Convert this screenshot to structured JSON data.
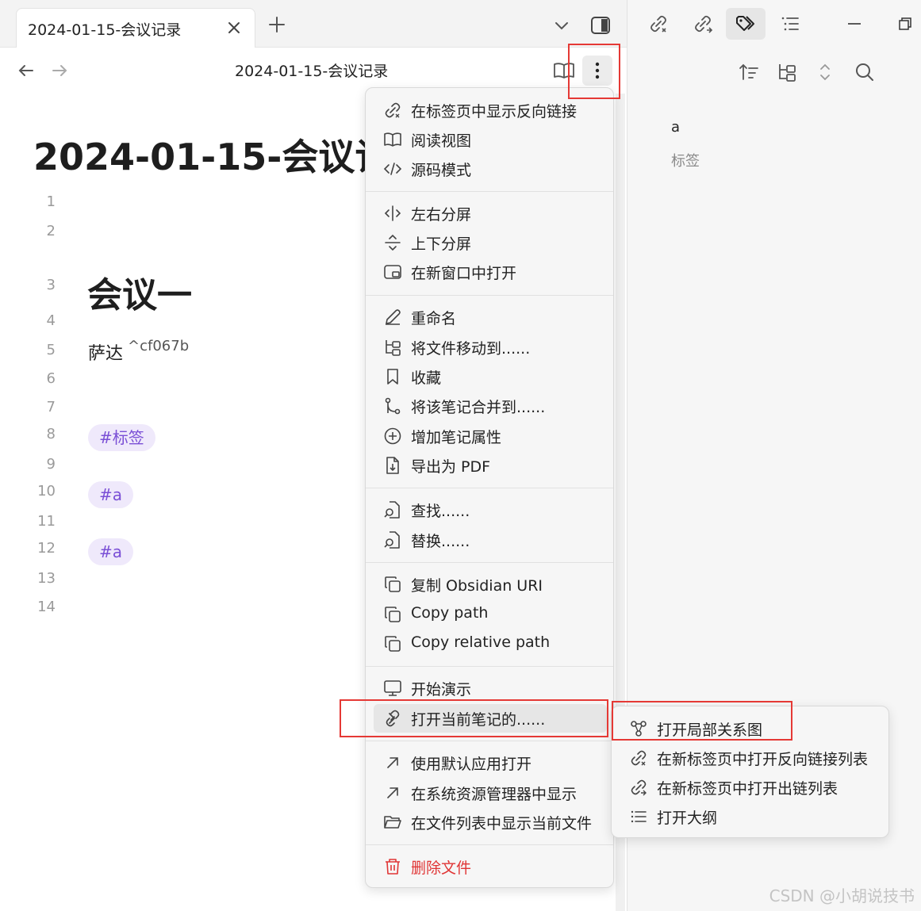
{
  "tab": {
    "title": "2024-01-15-会议记录"
  },
  "navbar": {
    "title": "2024-01-15-会议记录"
  },
  "document": {
    "title": "2024-01-15-会议记录",
    "line_numbers": [
      "1",
      "2",
      "3",
      "4",
      "5",
      "6",
      "7",
      "8",
      "9",
      "10",
      "11",
      "12",
      "13",
      "14"
    ],
    "heading": "会议一",
    "line5_text": "萨达",
    "line5_block_ref": "^cf067b",
    "tags": [
      "#标签",
      "#a",
      "#a"
    ]
  },
  "sidebar": {
    "tags": [
      "a",
      "标签"
    ]
  },
  "menu": {
    "groups": [
      [
        {
          "label": "在标签页中显示反向链接",
          "icon": "backlink-icon"
        },
        {
          "label": "阅读视图",
          "icon": "book-open-icon"
        },
        {
          "label": "源码模式",
          "icon": "code-icon"
        }
      ],
      [
        {
          "label": "左右分屏",
          "icon": "split-vertical-icon"
        },
        {
          "label": "上下分屏",
          "icon": "split-horizontal-icon"
        },
        {
          "label": "在新窗口中打开",
          "icon": "new-window-icon"
        }
      ],
      [
        {
          "label": "重命名",
          "icon": "pencil-icon"
        },
        {
          "label": "将文件移动到......",
          "icon": "folder-tree-icon"
        },
        {
          "label": "收藏",
          "icon": "bookmark-icon"
        },
        {
          "label": "将该笔记合并到......",
          "icon": "git-merge-icon"
        },
        {
          "label": "增加笔记属性",
          "icon": "plus-circle-icon"
        },
        {
          "label": "导出为 PDF",
          "icon": "file-export-icon"
        }
      ],
      [
        {
          "label": "查找......",
          "icon": "file-search-icon"
        },
        {
          "label": "替换......",
          "icon": "file-replace-icon"
        }
      ],
      [
        {
          "label": "复制 Obsidian URI",
          "icon": "copy-icon"
        },
        {
          "label": "Copy path",
          "icon": "copy-icon"
        },
        {
          "label": "Copy relative path",
          "icon": "copy-icon"
        }
      ],
      [
        {
          "label": "开始演示",
          "icon": "monitor-icon"
        },
        {
          "label": "打开当前笔记的......",
          "icon": "link-icon",
          "submenu": true
        }
      ],
      [
        {
          "label": "使用默认应用打开",
          "icon": "arrow-up-right-icon"
        },
        {
          "label": "在系统资源管理器中显示",
          "icon": "arrow-up-right-icon"
        },
        {
          "label": "在文件列表中显示当前文件",
          "icon": "folder-open-icon"
        }
      ],
      [
        {
          "label": "删除文件",
          "icon": "trash-icon",
          "danger": true
        }
      ]
    ]
  },
  "submenu": {
    "items": [
      {
        "label": "打开局部关系图",
        "icon": "graph-icon"
      },
      {
        "label": "在新标签页中打开反向链接列表",
        "icon": "backlink-icon"
      },
      {
        "label": "在新标签页中打开出链列表",
        "icon": "outgoing-link-icon"
      },
      {
        "label": "打开大纲",
        "icon": "list-icon"
      }
    ]
  },
  "watermark": "CSDN @小胡说技书",
  "colors": {
    "accent_tag_bg": "#efe9fb",
    "accent_tag_text": "#7a4fd6",
    "danger": "#e03535",
    "highlight_box": "#e53935"
  }
}
